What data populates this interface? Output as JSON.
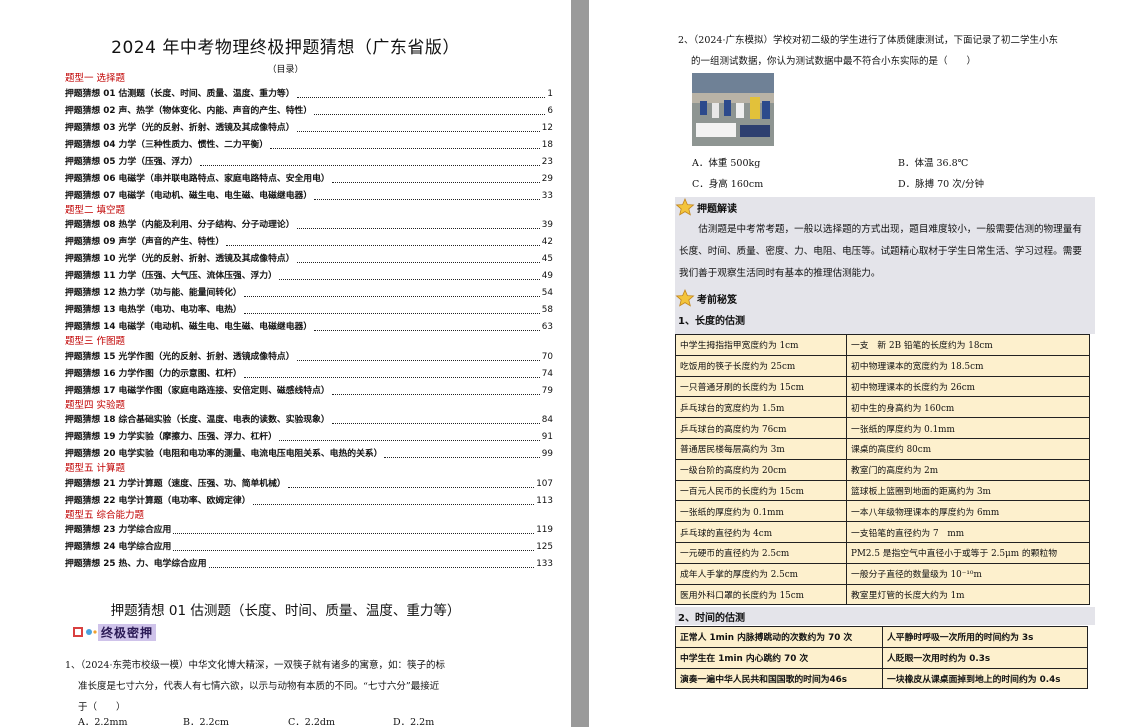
{
  "left_page": {
    "title": "2024 年中考物理终极押题猜想（广东省版）",
    "toc_label": "（目录）",
    "toc": [
      {
        "section": "题型一 选择题",
        "items": [
          {
            "title": "押题猜想 01 估测题（长度、时间、质量、温度、重力等）",
            "page": "1"
          },
          {
            "title": "押题猜想 02 声、热学（物体变化、内能、声音的产生、特性）",
            "page": "6"
          },
          {
            "title": "押题猜想 03 光学（光的反射、折射、透镜及其成像特点）",
            "page": "12"
          },
          {
            "title": "押题猜想 04 力学（三种性质力、惯性、二力平衡）",
            "page": "18"
          },
          {
            "title": "押题猜想 05 力学（压强、浮力）",
            "page": "23"
          },
          {
            "title": "押题猜想 06 电磁学（串并联电路特点、家庭电路特点、安全用电）",
            "page": "29"
          },
          {
            "title": "押题猜想 07 电磁学（电动机、磁生电、电生磁、电磁继电器）",
            "page": "33"
          }
        ]
      },
      {
        "section": "题型二 填空题",
        "items": [
          {
            "title": "押题猜想 08 热学（内能及利用、分子结构、分子动理论）",
            "page": "39"
          },
          {
            "title": "押题猜想 09 声学（声音的产生、特性）",
            "page": "42"
          },
          {
            "title": "押题猜想 10 光学（光的反射、折射、透镜及其成像特点）",
            "page": "45"
          },
          {
            "title": "押题猜想 11 力学（压强、大气压、流体压强、浮力）",
            "page": "49"
          },
          {
            "title": "押题猜想 12 热力学（功与能、能量间转化）",
            "page": "54"
          },
          {
            "title": "押题猜想 13 电热学（电功、电功率、电热）",
            "page": "58"
          },
          {
            "title": "押题猜想 14 电磁学（电动机、磁生电、电生磁、电磁继电器）",
            "page": "63"
          }
        ]
      },
      {
        "section": "题型三 作图题",
        "items": [
          {
            "title": "押题猜想 15 光学作图（光的反射、折射、透镜成像特点）",
            "page": "70"
          },
          {
            "title": "押题猜想 16 力学作图（力的示意图、杠杆）",
            "page": "74"
          },
          {
            "title": "押题猜想 17 电磁学作图（家庭电路连接、安倍定则、磁感线特点）",
            "page": "79"
          }
        ]
      },
      {
        "section": "题型四 实验题",
        "items": [
          {
            "title": "押题猜想 18 综合基础实验（长度、温度、电表的读数、实验现象）",
            "page": "84"
          },
          {
            "title": "押题猜想 19 力学实验（摩擦力、压强、浮力、杠杆）",
            "page": "91"
          },
          {
            "title": "押题猜想 20 电学实验（电阻和电功率的测量、电流电压电阻关系、电热的关系）",
            "page": "99"
          }
        ]
      },
      {
        "section": "题型五 计算题",
        "items": [
          {
            "title": "押题猜想 21 力学计算题（速度、压强、功、简单机械）",
            "page": "107"
          },
          {
            "title": "押题猜想 22 电学计算题（电功率、欧姆定律）",
            "page": "113"
          }
        ]
      },
      {
        "section": "题型五 综合能力题",
        "items": [
          {
            "title": "押题猜想 23 力学综合应用",
            "page": "119"
          },
          {
            "title": "押题猜想 24 电学综合应用",
            "page": "125"
          },
          {
            "title": "押题猜想 25 热、力、电学综合应用",
            "page": "133"
          }
        ]
      }
    ],
    "heading": "押题猜想 01 估测题（长度、时间、质量、温度、重力等）",
    "badge": "终极密押",
    "question1": {
      "line1": "1、（2024·东莞市校级一模）中华文化博大精深，一双筷子就有诸多的寓意，如：筷子的标",
      "line2": "准长度是七寸六分，代表人有七情六欲，以示与动物有本质的不同。“七寸六分”最接近",
      "line3": "于（　　）",
      "options": [
        "A．2.2mm",
        "B．2.2cm",
        "C．2.2dm",
        "D．2.2m"
      ]
    }
  },
  "right_page": {
    "question2": {
      "line1": "2、（2024·广东模拟）学校对初二级的学生进行了体质健康测试，下面记录了初二学生小东",
      "line2": "的一组测试数据，你认为测试数据中最不符合小东实际的是（　　）",
      "options": [
        "A．体重 500kg",
        "B．体温 36.8℃",
        "C．身高 160cm",
        "D．脉搏 70 次/分钟"
      ]
    },
    "box1": {
      "title": "押题解读",
      "text": "估测题是中考常考题，一般以选择题的方式出现，题目难度较小，一般需要估测的物理量有长度、时间、质量、密度、力、电阻、电压等。试题精心取材于学生日常生活、学习过程。需要我们善于观察生活同时有基本的推理估测能力。"
    },
    "box2_title": "考前秘笈",
    "section1": "1、长度的估测",
    "length_rows": [
      [
        "中学生拇指指甲宽度约为 1cm",
        "一支　新 2B 铅笔的长度约为 18cm"
      ],
      [
        "吃饭用的筷子长度约为 25cm",
        "初中物理课本的宽度约为 18.5cm"
      ],
      [
        "一只普通牙刷的长度约为 15cm",
        "初中物理课本的长度约为 26cm"
      ],
      [
        "乒乓球台的宽度约为 1.5m",
        "初中生的身高约为 160cm"
      ],
      [
        "乒乓球台的高度约为 76cm",
        "一张纸的厚度约为 0.1mm"
      ],
      [
        "普通居民楼每层高约为 3m",
        "课桌的高度约 80cm"
      ],
      [
        "一级台阶的高度约为 20cm",
        "教室门的高度约为 2m"
      ],
      [
        "一百元人民币的长度约为 15cm",
        "篮球板上篮圈到地面的距离约为 3m"
      ],
      [
        "一张纸的厚度约为 0.1mm",
        "一本八年级物理课本的厚度约为 6mm"
      ],
      [
        "乒乓球的直径约为 4cm",
        "一支铅笔的直径约为 7　mm"
      ],
      [
        "一元硬币的直径约为 2.5cm",
        "PM2.5 是指空气中直径小于或等于 2.5μm 的颗粒物"
      ],
      [
        "成年人手掌的厚度约为 2.5cm",
        "一般分子直径的数量级为 10⁻¹⁰m"
      ],
      [
        "医用外科口罩的长度约为 15cm",
        "教室里灯管的长度大约为 1m"
      ]
    ],
    "section2": "2、时间的估测",
    "time_rows": [
      [
        "正常人 1min 内脉搏跳动的次数约为 70 次",
        "人平静时呼吸一次所用的时间约为 3s"
      ],
      [
        "中学生在 1min 内心跳约 70 次",
        "人眨眼一次用时约为 0.3s"
      ],
      [
        "演奏一遍中华人民共和国国歌的时间为46s",
        "一块橡皮从课桌面掉到地上的时间约为 0.4s"
      ]
    ]
  }
}
